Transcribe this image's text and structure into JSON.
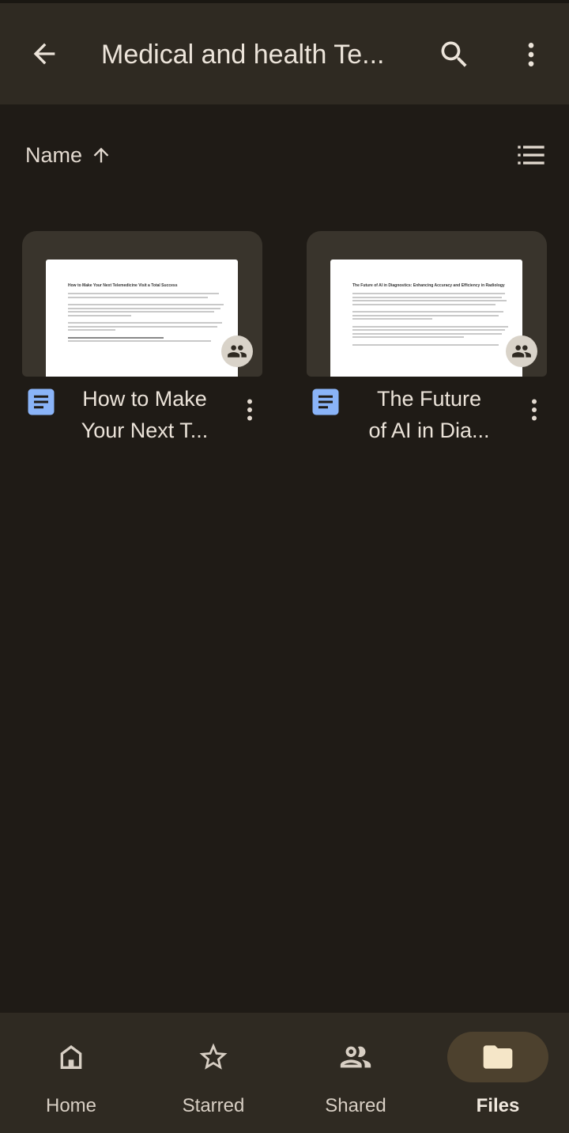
{
  "header": {
    "title": "Medical and health Te..."
  },
  "sort": {
    "label": "Name"
  },
  "files": [
    {
      "name_line1": "How to Make",
      "name_line2": "Your Next T...",
      "preview_title": "How to Make Your Next Telemedicine Visit a Total Success"
    },
    {
      "name_line1": "The Future",
      "name_line2": "of AI in Dia...",
      "preview_title": "The Future of AI in Diagnostics: Enhancing Accuracy and Efficiency in Radiology"
    }
  ],
  "nav": {
    "home": "Home",
    "starred": "Starred",
    "shared": "Shared",
    "files": "Files"
  },
  "colors": {
    "background": "#1f1b16",
    "bar": "#2f2a22",
    "doc_icon": "#8ab4f8",
    "active_pill": "#4d412e"
  }
}
